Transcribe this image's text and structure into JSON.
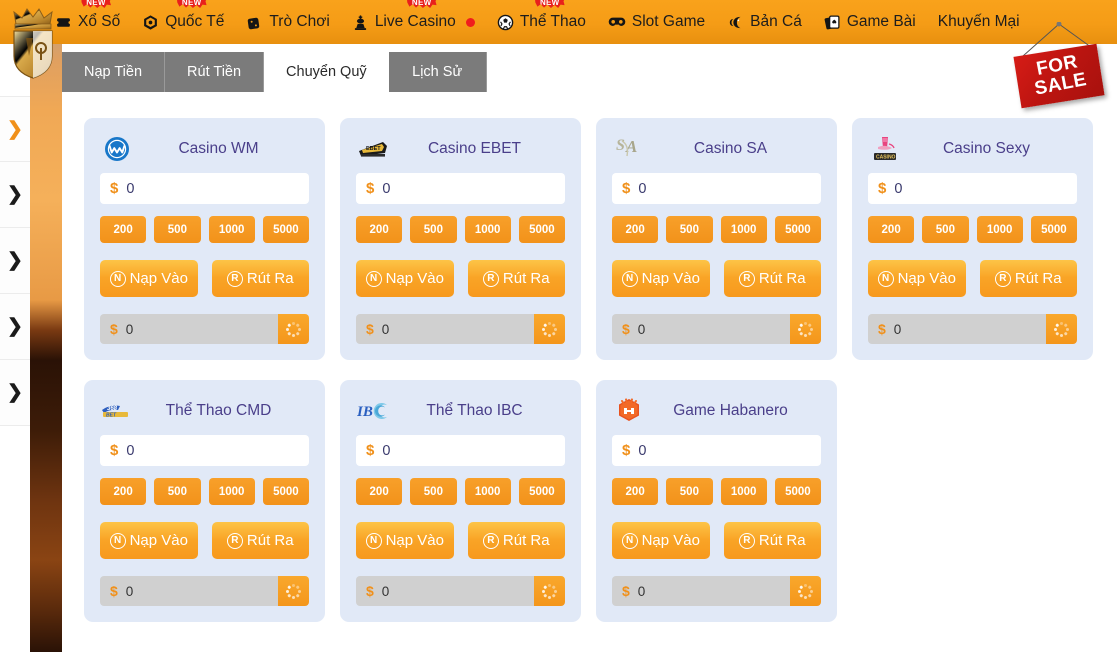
{
  "topnav": {
    "items": [
      {
        "label": "Xổ Số",
        "icon": "ticket-icon",
        "new": true,
        "live": false
      },
      {
        "label": "Quốc Tế",
        "icon": "globe-icon",
        "new": true,
        "live": false
      },
      {
        "label": "Trò Chơi",
        "icon": "dice-icon",
        "new": false,
        "live": false
      },
      {
        "label": "Live Casino",
        "icon": "chess-king-icon",
        "new": true,
        "live": true
      },
      {
        "label": "Thể Thao",
        "icon": "soccer-icon",
        "new": true,
        "live": false
      },
      {
        "label": "Slot Game",
        "icon": "gamepad-icon",
        "new": false,
        "live": false
      },
      {
        "label": "Bản Cá",
        "icon": "fish-icon",
        "new": false,
        "live": false
      },
      {
        "label": "Game Bài",
        "icon": "cards-icon",
        "new": false,
        "live": false
      },
      {
        "label": "Khuyến Mại",
        "icon": "",
        "new": false,
        "live": false
      }
    ],
    "new_badge_label": "NEW"
  },
  "logo": {
    "name": "crown-shield-logo"
  },
  "for_sale": {
    "line1": "FOR",
    "line2": "SALE",
    "color": "#c2150f"
  },
  "left_rail": {
    "items": [
      {
        "name": "rail-item-1",
        "icon": "chevron-right-icon",
        "active": true
      },
      {
        "name": "rail-item-2",
        "icon": "chevron-right-icon",
        "active": false
      },
      {
        "name": "rail-item-3",
        "icon": "chevron-right-icon",
        "active": false
      },
      {
        "name": "rail-item-4",
        "icon": "chevron-right-icon",
        "active": false
      },
      {
        "name": "rail-item-5",
        "icon": "chevron-right-icon",
        "active": false
      }
    ]
  },
  "tabs": [
    {
      "label": "Nạp Tiền",
      "active": false
    },
    {
      "label": "Rút Tiền",
      "active": false
    },
    {
      "label": "Chuyển Quỹ",
      "active": true
    },
    {
      "label": "Lịch Sử",
      "active": false
    }
  ],
  "card_common": {
    "currency_symbol": "$",
    "amount_value": "0",
    "amount_placeholder": "0",
    "quick_amounts": [
      "200",
      "500",
      "1000",
      "5000"
    ],
    "deposit_label": "Nạp Vào",
    "deposit_icon_letter": "N",
    "withdraw_label": "Rút Ra",
    "withdraw_icon_letter": "R",
    "balance_value": "0",
    "refresh_icon": "spinner-refresh-icon",
    "accent_color": "#f59c16",
    "card_bg": "#e1e9f7",
    "title_color": "#4a3f8a"
  },
  "cards": [
    {
      "title": "Casino WM",
      "logo": "casino-wm-logo"
    },
    {
      "title": "Casino EBET",
      "logo": "casino-ebet-logo"
    },
    {
      "title": "Casino SA",
      "logo": "casino-sa-logo"
    },
    {
      "title": "Casino Sexy",
      "logo": "casino-sexy-logo"
    },
    {
      "title": "Thể Thao CMD",
      "logo": "cmd-sports-logo"
    },
    {
      "title": "Thể Thao IBC",
      "logo": "ibc-sports-logo"
    },
    {
      "title": "Game Habanero",
      "logo": "habanero-logo"
    }
  ]
}
